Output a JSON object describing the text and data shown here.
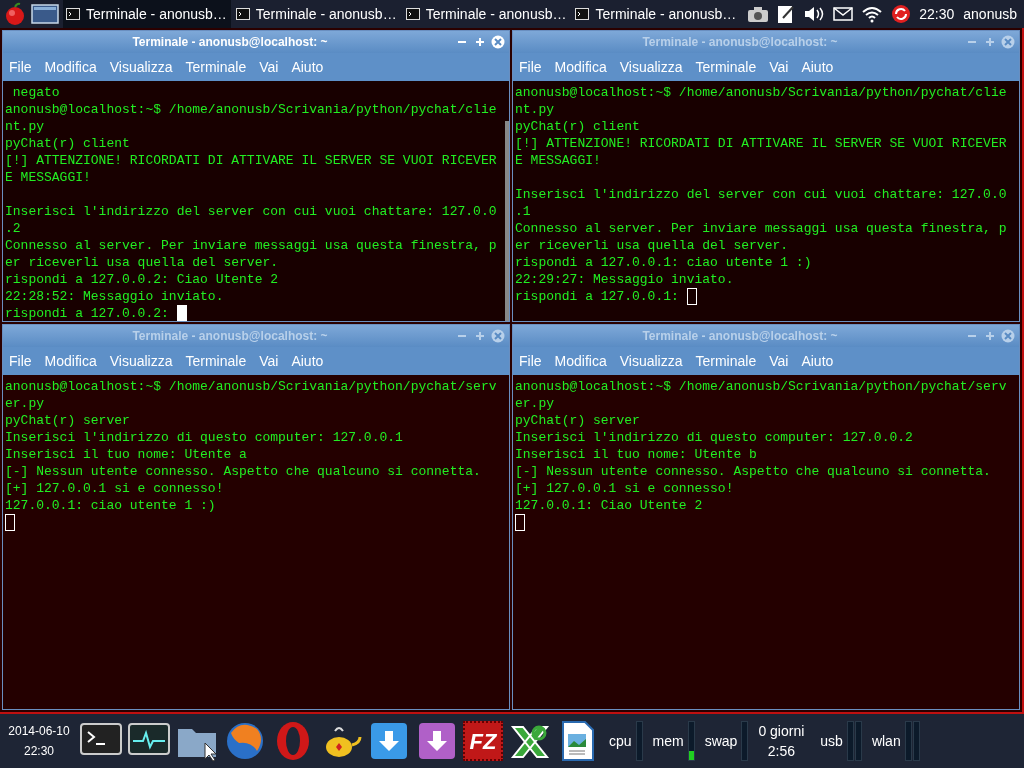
{
  "top_panel": {
    "tasks": [
      {
        "label": "Terminale - anonusb…",
        "selected": true
      },
      {
        "label": "Terminale - anonusb…",
        "selected": false
      },
      {
        "label": "Terminale - anonusb…",
        "selected": false
      },
      {
        "label": "Terminale - anonusb…",
        "selected": false
      }
    ],
    "clock": "22:30",
    "user": "anonusb"
  },
  "windows": [
    {
      "title": "Terminale - anonusb@localhost: ~",
      "active": true,
      "scrollbar": true,
      "menu": [
        "File",
        "Modifica",
        "Visualizza",
        "Terminale",
        "Vai",
        "Aiuto"
      ],
      "blocks": [
        [
          " negato",
          "anonusb@localhost:~$ /home/anonusb/Scrivania/python/pychat/clie",
          "nt.py",
          "pyChat(r) client",
          "[!] ATTENZIONE! RICORDATI DI ATTIVARE IL SERVER SE VUOI RICEVER",
          "E MESSAGGI!"
        ],
        [
          "Inserisci l'indirizzo del server con cui vuoi chattare: 127.0.0",
          ".2",
          "Connesso al server. Per inviare messaggi usa questa finestra, p",
          "er riceverli usa quella del server.",
          "rispondi a 127.0.0.2: Ciao Utente 2",
          "22:28:52: Messaggio inviato."
        ]
      ],
      "prompt": "rispondi a 127.0.0.2: "
    },
    {
      "title": "Terminale - anonusb@localhost: ~",
      "active": false,
      "scrollbar": false,
      "menu": [
        "File",
        "Modifica",
        "Visualizza",
        "Terminale",
        "Vai",
        "Aiuto"
      ],
      "blocks": [
        [
          "anonusb@localhost:~$ /home/anonusb/Scrivania/python/pychat/clie",
          "nt.py",
          "pyChat(r) client",
          "[!] ATTENZIONE! RICORDATI DI ATTIVARE IL SERVER SE VUOI RICEVER",
          "E MESSAGGI!"
        ],
        [
          "Inserisci l'indirizzo del server con cui vuoi chattare: 127.0.0",
          ".1",
          "Connesso al server. Per inviare messaggi usa questa finestra, p",
          "er riceverli usa quella del server.",
          "rispondi a 127.0.0.1: ciao utente 1 :)",
          "22:29:27: Messaggio inviato."
        ]
      ],
      "prompt": "rispondi a 127.0.0.1: "
    },
    {
      "title": "Terminale - anonusb@localhost: ~",
      "active": false,
      "scrollbar": false,
      "menu": [
        "File",
        "Modifica",
        "Visualizza",
        "Terminale",
        "Vai",
        "Aiuto"
      ],
      "blocks": [
        [
          "anonusb@localhost:~$ /home/anonusb/Scrivania/python/pychat/serv",
          "er.py",
          "pyChat(r) server",
          "Inserisci l'indirizzo di questo computer: 127.0.0.1",
          "Inserisci il tuo nome: Utente a",
          "[-] Nessun utente connesso. Aspetto che qualcuno si connetta.",
          "[+] 127.0.0.1 si e connesso!",
          "127.0.0.1: ciao utente 1 :)"
        ]
      ]
    },
    {
      "title": "Terminale - anonusb@localhost: ~",
      "active": false,
      "scrollbar": false,
      "menu": [
        "File",
        "Modifica",
        "Visualizza",
        "Terminale",
        "Vai",
        "Aiuto"
      ],
      "blocks": [
        [
          "anonusb@localhost:~$ /home/anonusb/Scrivania/python/pychat/serv",
          "er.py",
          "pyChat(r) server",
          "Inserisci l'indirizzo di questo computer: 127.0.0.2",
          "Inserisci il tuo nome: Utente b",
          "[-] Nessun utente connesso. Aspetto che qualcuno si connetta.",
          "[+] 127.0.0.1 si e connesso!",
          "127.0.0.1: Ciao Utente 2"
        ]
      ]
    }
  ],
  "bottom_panel": {
    "date": "2014-06-10",
    "time": "22:30",
    "launcher_badge": "FZ",
    "meters": [
      {
        "label": "cpu",
        "bars": [
          {
            "level": 0
          }
        ]
      },
      {
        "label": "mem",
        "bars": [
          {
            "level": 0.25
          }
        ]
      },
      {
        "label": "swap",
        "bars": [
          {
            "level": 0
          }
        ]
      }
    ],
    "uptime": [
      "0 giorni",
      "2:56"
    ],
    "net_meters": [
      {
        "label": "usb",
        "bars": [
          {
            "level": 0
          },
          {
            "level": 0
          }
        ]
      },
      {
        "label": "wlan",
        "bars": [
          {
            "level": 0
          },
          {
            "level": 0
          }
        ]
      }
    ]
  }
}
